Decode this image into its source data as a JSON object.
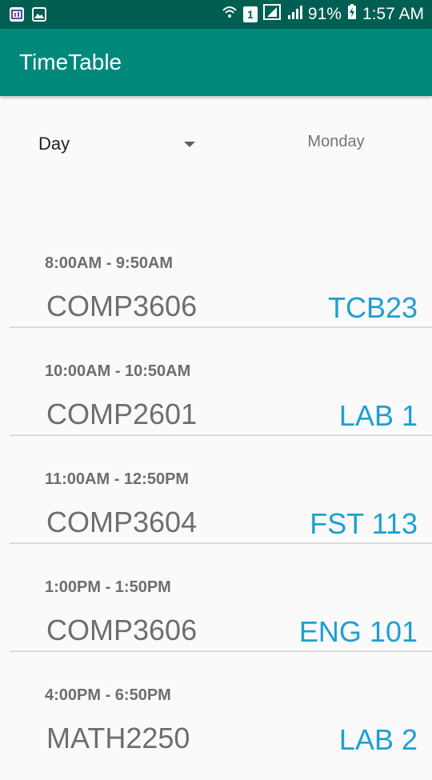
{
  "status_bar": {
    "battery": "91%",
    "time": "1:57 AM",
    "sim_slot": "1"
  },
  "app_bar": {
    "title": "TimeTable"
  },
  "controls": {
    "view_mode": "Day",
    "day": "Monday"
  },
  "schedule": [
    {
      "time": "8:00AM - 9:50AM",
      "course": "COMP3606",
      "room": "TCB23"
    },
    {
      "time": "10:00AM - 10:50AM",
      "course": "COMP2601",
      "room": "LAB 1"
    },
    {
      "time": "11:00AM - 12:50PM",
      "course": "COMP3604",
      "room": "FST 113"
    },
    {
      "time": "1:00PM - 1:50PM",
      "course": "COMP3606",
      "room": "ENG 101"
    },
    {
      "time": "4:00PM - 6:50PM",
      "course": "MATH2250",
      "room": "LAB 2"
    }
  ],
  "colors": {
    "status_bar": "#005e52",
    "app_bar": "#00897b",
    "room_text": "#1e9fd4"
  }
}
